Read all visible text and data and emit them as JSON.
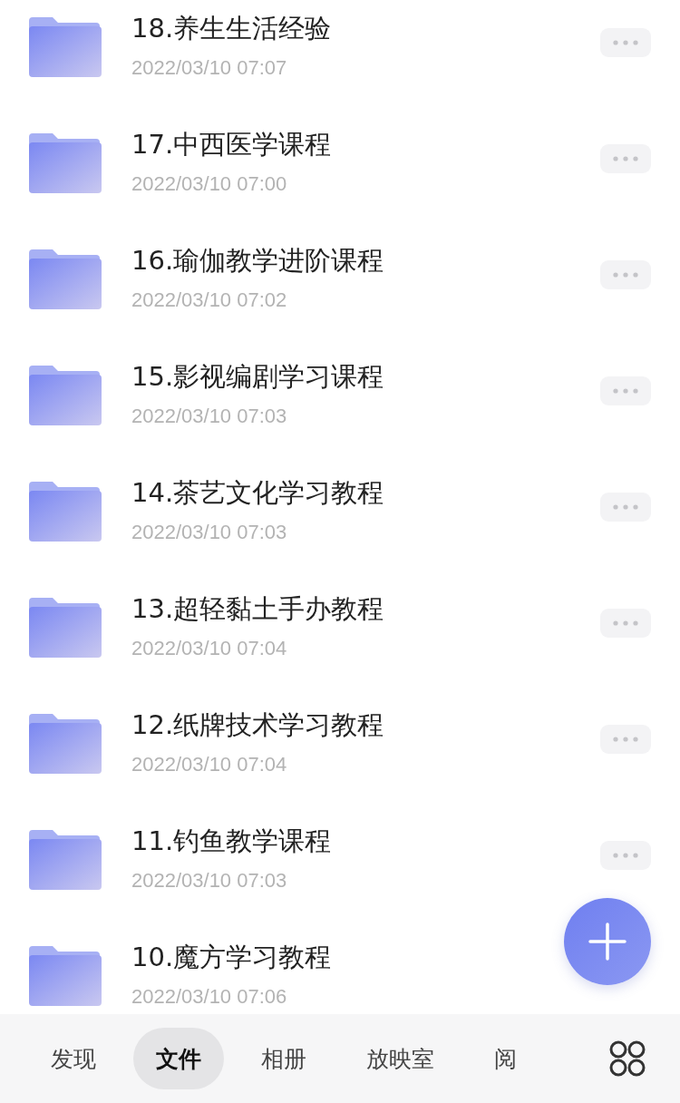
{
  "files": [
    {
      "name": "18.养生生活经验",
      "date": "2022/03/10 07:07"
    },
    {
      "name": "17.中西医学课程",
      "date": "2022/03/10 07:00"
    },
    {
      "name": "16.瑜伽教学进阶课程",
      "date": "2022/03/10 07:02"
    },
    {
      "name": "15.影视编剧学习课程",
      "date": "2022/03/10 07:03"
    },
    {
      "name": "14.茶艺文化学习教程",
      "date": "2022/03/10 07:03"
    },
    {
      "name": "13.超轻黏土手办教程",
      "date": "2022/03/10 07:04"
    },
    {
      "name": "12.纸牌技术学习教程",
      "date": "2022/03/10 07:04"
    },
    {
      "name": "11.钓鱼教学课程",
      "date": "2022/03/10 07:03"
    },
    {
      "name": "10.魔方学习教程",
      "date": "2022/03/10 07:06"
    }
  ],
  "tabs": [
    {
      "label": "发现",
      "selected": false
    },
    {
      "label": "文件",
      "selected": true
    },
    {
      "label": "相册",
      "selected": false
    },
    {
      "label": "放映室",
      "selected": false
    },
    {
      "label": "阅",
      "selected": false
    }
  ]
}
